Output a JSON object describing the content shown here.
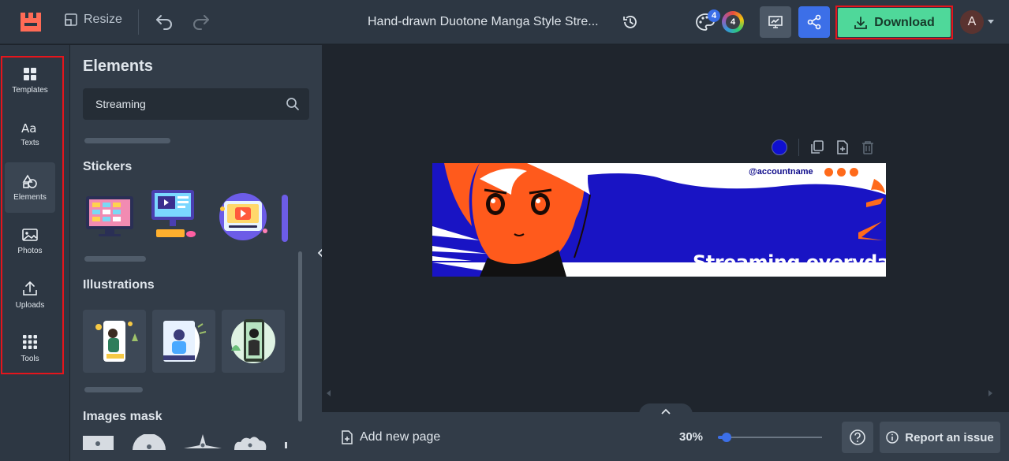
{
  "topbar": {
    "resize_label": "Resize",
    "document_title": "Hand-drawn Duotone Manga Style Stre...",
    "palette_badge": "4",
    "color_count": "4",
    "download_label": "Download",
    "avatar_initial": "A"
  },
  "sidebar": {
    "items": [
      {
        "label": "Templates",
        "icon": "templates-icon"
      },
      {
        "label": "Texts",
        "icon": "texts-icon"
      },
      {
        "label": "Elements",
        "icon": "elements-icon",
        "active": true
      },
      {
        "label": "Photos",
        "icon": "photos-icon"
      },
      {
        "label": "Uploads",
        "icon": "upload-icon"
      },
      {
        "label": "Tools",
        "icon": "tools-icon"
      }
    ]
  },
  "panel": {
    "title": "Elements",
    "search_value": "Streaming",
    "sections": [
      {
        "title": "Stickers"
      },
      {
        "title": "Illustrations"
      },
      {
        "title": "Images mask"
      }
    ]
  },
  "canvas": {
    "selected_color": "#0f0fcf",
    "banner": {
      "account": "@accountname",
      "headline": "Streaming everyday",
      "background_color": "#1914c4",
      "accent_color": "#ff6a1a"
    }
  },
  "bottombar": {
    "add_page_label": "Add new page",
    "zoom_label": "30%",
    "zoom_value": 0.08,
    "report_label": "Report an issue"
  },
  "colors": {
    "download_green": "#4fd89a",
    "share_blue": "#3c6fe8",
    "highlight_red": "#e5151c"
  }
}
